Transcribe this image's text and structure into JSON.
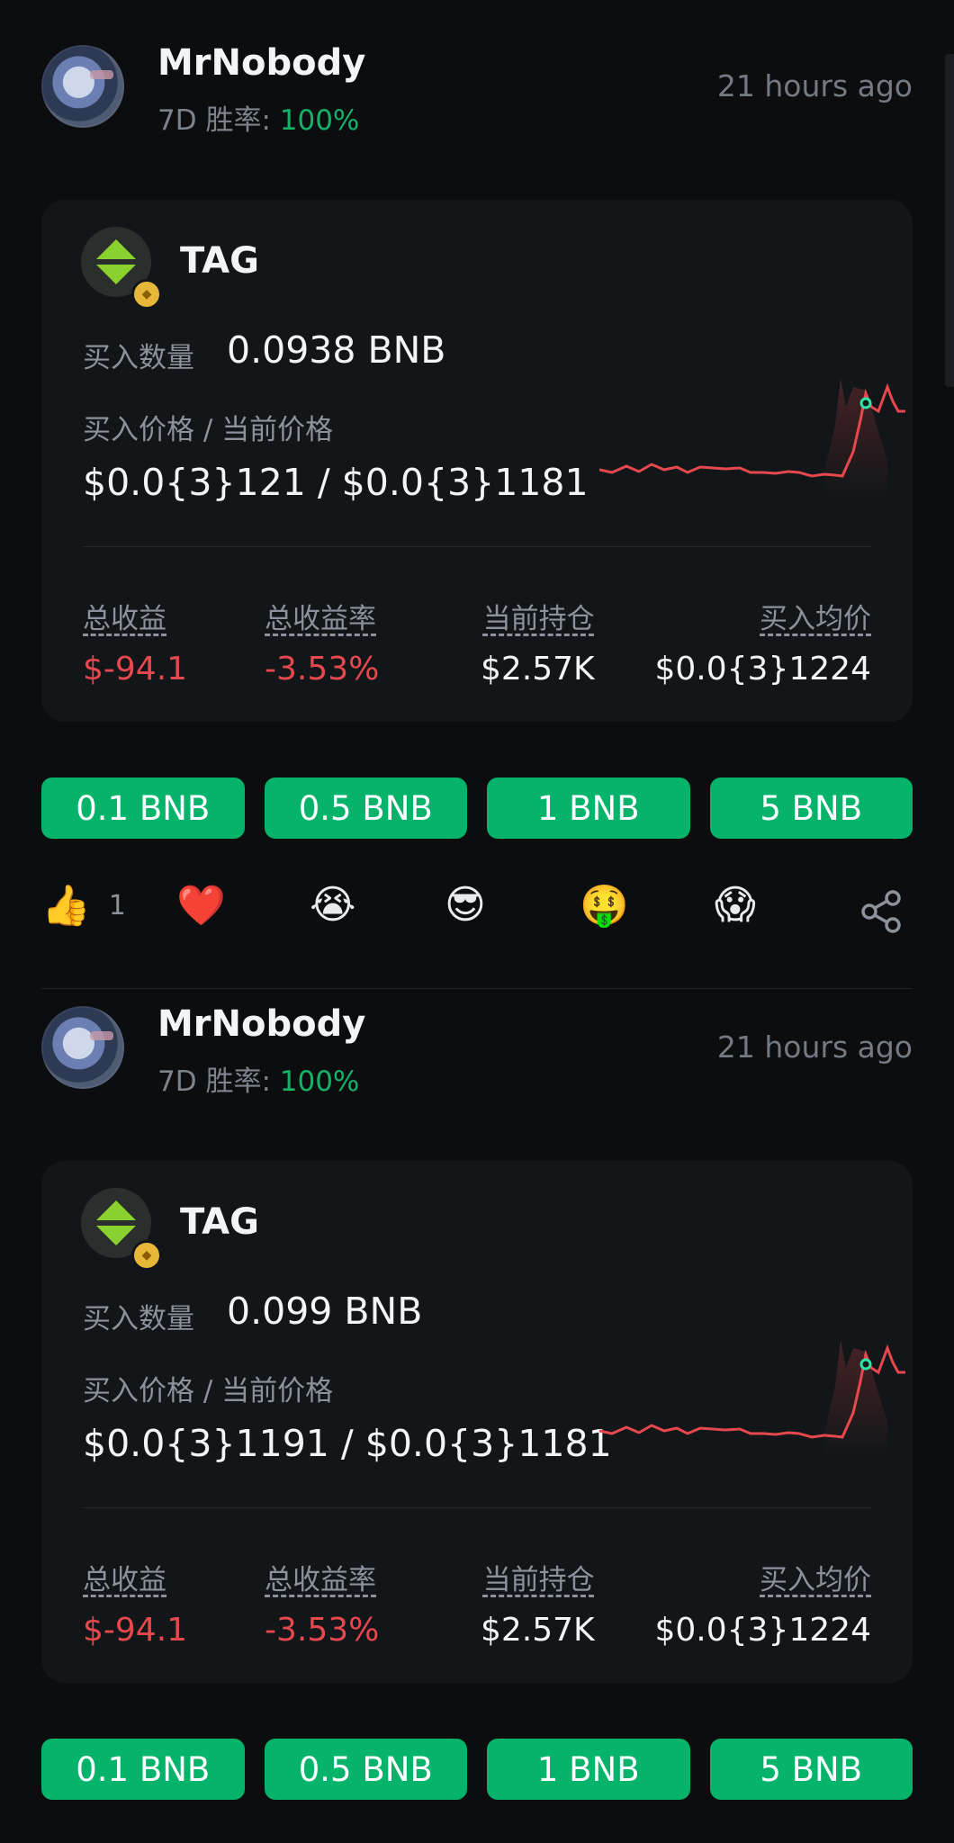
{
  "posts": [
    {
      "username": "MrNobody",
      "winrate_label": "7D 胜率: ",
      "winrate_value": "100%",
      "time": "21 hours ago",
      "token": "TAG",
      "buy_qty_label": "买入数量",
      "buy_qty_value": "0.0938 BNB",
      "price_label": "买入价格 / 当前价格",
      "price_value": "$0.0{3}121 / $0.0{3}1181",
      "stats": {
        "total_label": "总收益",
        "total_value": "$-94.1",
        "rate_label": "总收益率",
        "rate_value": "-3.53%",
        "hold_label": "当前持仓",
        "hold_value": "$2.57K",
        "avg_label": "买入均价",
        "avg_value": "$0.0{3}1224"
      },
      "buttons": [
        "0.1 BNB",
        "0.5 BNB",
        "1 BNB",
        "5 BNB"
      ],
      "reactions": {
        "thumbs_up_count": "1"
      }
    },
    {
      "username": "MrNobody",
      "winrate_label": "7D 胜率: ",
      "winrate_value": "100%",
      "time": "21 hours ago",
      "token": "TAG",
      "buy_qty_label": "买入数量",
      "buy_qty_value": "0.099 BNB",
      "price_label": "买入价格 / 当前价格",
      "price_value": "$0.0{3}1191 / $0.0{3}1181",
      "stats": {
        "total_label": "总收益",
        "total_value": "$-94.1",
        "rate_label": "总收益率",
        "rate_value": "-3.53%",
        "hold_label": "当前持仓",
        "hold_value": "$2.57K",
        "avg_label": "买入均价",
        "avg_value": "$0.0{3}1224"
      },
      "buttons": [
        "0.1 BNB",
        "0.5 BNB",
        "1 BNB",
        "5 BNB"
      ]
    }
  ],
  "colors": {
    "accent_green": "#06b36b",
    "positive": "#17b26a",
    "negative": "#e5484d",
    "background": "#0b0d0f",
    "card": "#121619"
  },
  "icons": [
    "thumbs-up-icon",
    "heart-icon",
    "crying-face-icon",
    "sunglasses-face-icon",
    "money-mouth-face-icon",
    "screaming-face-icon",
    "share-icon"
  ]
}
